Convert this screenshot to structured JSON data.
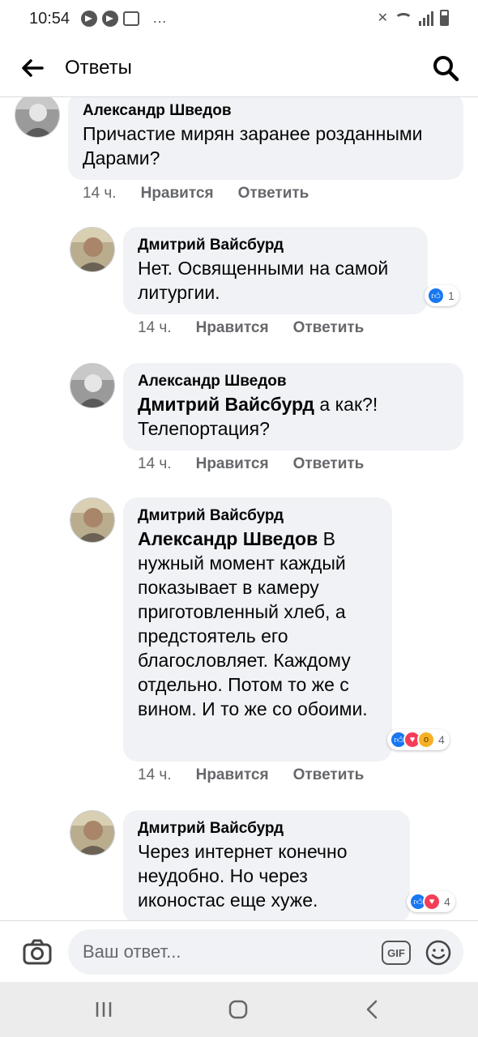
{
  "status_bar": {
    "time": "10:54",
    "dots": "…"
  },
  "header": {
    "title": "Ответы",
    "back_icon": "arrow-left-icon",
    "search_icon": "search-icon"
  },
  "comments": [
    {
      "author": "Александр Шведов",
      "mention": "",
      "text": "Причастие мирян заранее розданными Дарами?",
      "time": "14 ч.",
      "like_label": "Нравится",
      "reply_label": "Ответить",
      "reactions": null
    },
    {
      "author": "Дмитрий Вайсбурд",
      "mention": "",
      "text": "Нет. Освященными на самой литургии.",
      "time": "14 ч.",
      "like_label": "Нравится",
      "reply_label": "Ответить",
      "reactions": {
        "count": "1",
        "types": [
          "like"
        ]
      }
    },
    {
      "author": "Александр Шведов",
      "mention": "Дмитрий Вайсбурд",
      "text": " а как?! Телепортация?",
      "time": "14 ч.",
      "like_label": "Нравится",
      "reply_label": "Ответить",
      "reactions": null
    },
    {
      "author": "Дмитрий Вайсбурд",
      "mention": "Александр Шведов",
      "text": " В нужный момент каждый показывает в камеру приготовленный хлеб, а предстоятель его благословляет. Каждому отдельно. Потом то же с вином. И то же со обоими.",
      "time": "14 ч.",
      "like_label": "Нравится",
      "reply_label": "Ответить",
      "reactions": {
        "count": "4",
        "types": [
          "like",
          "love",
          "wow"
        ]
      }
    },
    {
      "author": "Дмитрий Вайсбурд",
      "mention": "",
      "text": "Через интернет конечно неудобно. Но через иконостас еще хуже.",
      "time": "",
      "like_label": "",
      "reply_label": "",
      "reactions": {
        "count": "4",
        "types": [
          "like",
          "love"
        ]
      }
    }
  ],
  "composer": {
    "placeholder": "Ваш ответ...",
    "gif_label": "GIF"
  },
  "colors": {
    "bubble": "#f0f2f5",
    "secondary_text": "#65676b",
    "like_blue": "#1877f2",
    "love_red": "#f33e58",
    "wow_yellow": "#f7b125"
  }
}
